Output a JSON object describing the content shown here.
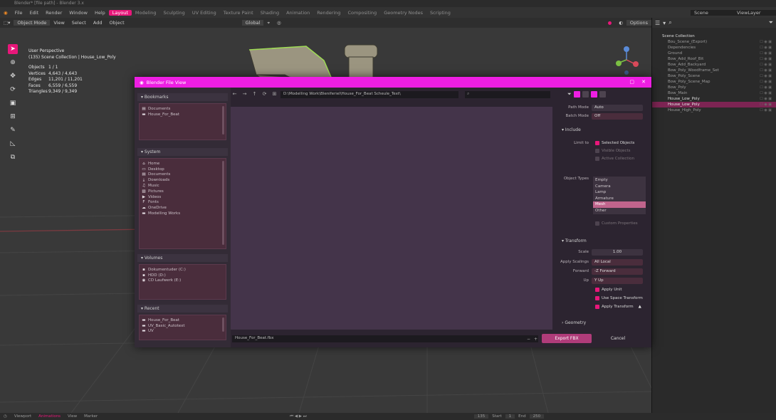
{
  "title": "Blender* [file path] - Blender 3.x",
  "menu": {
    "items": [
      "File",
      "Edit",
      "Render",
      "Window",
      "Help"
    ],
    "workspaces": [
      "Layout",
      "Modeling",
      "Sculpting",
      "UV Editing",
      "Texture Paint",
      "Shading",
      "Animation",
      "Rendering",
      "Compositing",
      "Geometry Nodes",
      "Scripting"
    ],
    "active_workspace": "Layout",
    "scene_label": "Scene",
    "view_layer_label": "ViewLayer"
  },
  "viewport": {
    "mode": "Object Mode",
    "menus": [
      "View",
      "Select",
      "Add",
      "Object"
    ],
    "transform": "Global",
    "options_label": "Options",
    "stats": {
      "title": "User Perspective",
      "collection": "(135) Scene Collection | House_Low_Poly",
      "rows": [
        {
          "k": "Objects",
          "v": "1 / 1"
        },
        {
          "k": "Vertices",
          "v": "4,643 / 4,643"
        },
        {
          "k": "Edges",
          "v": "11,201 / 11,201"
        },
        {
          "k": "Faces",
          "v": "6,559 / 6,559"
        },
        {
          "k": "Triangles",
          "v": "9,349 / 9,349"
        }
      ]
    }
  },
  "outliner": {
    "root": "Scene Collection",
    "items": [
      {
        "name": "Bou_Scene_(Export)",
        "state": ""
      },
      {
        "name": "Dependencies",
        "state": ""
      },
      {
        "name": "Ground",
        "state": ""
      },
      {
        "name": "Bow_Add_Roof_Bit",
        "state": ""
      },
      {
        "name": "Bow_Add_Backyard",
        "state": ""
      },
      {
        "name": "Bow_Poly_Woodframe_Set",
        "state": ""
      },
      {
        "name": "Bow_Poly_Scene",
        "state": ""
      },
      {
        "name": "Bow_Poly_Scene_Map",
        "state": ""
      },
      {
        "name": "Bow_Poly",
        "state": ""
      },
      {
        "name": "Bow_Main",
        "state": ""
      },
      {
        "name": "House_Low_Poly",
        "state": "hi"
      },
      {
        "name": "House_Low_Poly",
        "state": "sel"
      },
      {
        "name": "House_High_Poly",
        "state": ""
      }
    ]
  },
  "dialog": {
    "title": "Blender File View",
    "path": "D:\\Modelling Work\\Bleniferiel\\House_For_Beat Scheule_Text\\",
    "file_name": "House_For_Beat.fbx",
    "export_label": "Export FBX",
    "cancel_label": "Cancel",
    "bookmarks": {
      "header": "Bookmarks",
      "items": [
        {
          "icon": "documents",
          "label": "Documents"
        },
        {
          "icon": "folder",
          "label": "House_For_Beat"
        }
      ]
    },
    "system": {
      "header": "System",
      "items": [
        {
          "icon": "home",
          "label": "Home"
        },
        {
          "icon": "desktop",
          "label": "Desktop"
        },
        {
          "icon": "documents",
          "label": "Documents"
        },
        {
          "icon": "downloads",
          "label": "Downloads"
        },
        {
          "icon": "music",
          "label": "Music"
        },
        {
          "icon": "pictures",
          "label": "Pictures"
        },
        {
          "icon": "videos",
          "label": "Videos"
        },
        {
          "icon": "fonts",
          "label": "Fonts"
        },
        {
          "icon": "onedrive",
          "label": "OneDrive"
        },
        {
          "icon": "folder",
          "label": "Modelling Works"
        }
      ]
    },
    "volumes": {
      "header": "Volumes",
      "items": [
        {
          "icon": "drive",
          "label": "Dokumentuder (C:)"
        },
        {
          "icon": "drive",
          "label": "HDD (D:)"
        },
        {
          "icon": "disc",
          "label": "CD Laufwerk (E:)"
        }
      ]
    },
    "recent": {
      "header": "Recent",
      "items": [
        {
          "icon": "folder",
          "label": "House_For_Beat"
        },
        {
          "icon": "folder",
          "label": "UV_Basic_Autotext"
        },
        {
          "icon": "folder",
          "label": "UV"
        }
      ]
    },
    "options": {
      "path_mode_label": "Path Mode",
      "path_mode": "Auto",
      "batch_mode_label": "Batch Mode",
      "batch_mode": "Off",
      "include_header": "Include",
      "limit_to_label": "Limit to",
      "limit_to": [
        {
          "label": "Selected Objects",
          "on": true
        },
        {
          "label": "Visible Objects",
          "on": false
        },
        {
          "label": "Active Collection",
          "on": false
        }
      ],
      "object_types_label": "Object Types",
      "object_types": [
        "Empty",
        "Camera",
        "Lamp",
        "Armature",
        "Mesh",
        "Other"
      ],
      "object_types_selected": "Mesh",
      "custom_properties": "Custom Properties",
      "transform_header": "Transform",
      "scale_label": "Scale",
      "scale": "1.00",
      "apply_scalings_label": "Apply Scalings",
      "apply_scalings": "All Local",
      "forward_label": "Forward",
      "forward": "-Z Forward",
      "up_label": "Up",
      "up": "Y Up",
      "transform_checks": [
        {
          "label": "Apply Unit",
          "on": true
        },
        {
          "label": "Use Space Transform",
          "on": true
        },
        {
          "label": "Apply Transform",
          "on": true
        }
      ],
      "geometry_header": "Geometry"
    }
  },
  "statusbar": {
    "items": [
      "Viewport",
      "Animations",
      "View",
      "Marker"
    ],
    "frame": "135",
    "start_label": "Start",
    "start": "1",
    "end_label": "End",
    "end": "250"
  }
}
